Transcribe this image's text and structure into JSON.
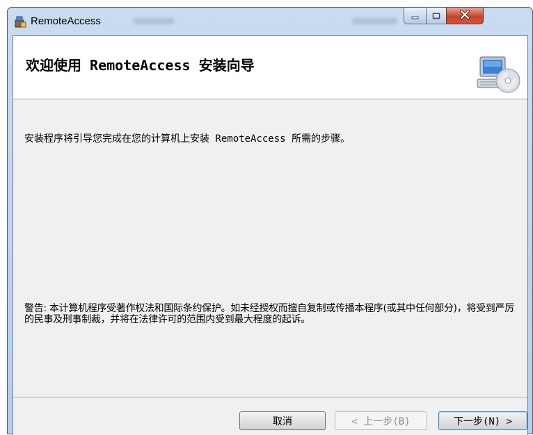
{
  "window": {
    "title": "RemoteAccess",
    "controls": {
      "minimize_icon": "minimize-icon",
      "maximize_icon": "maximize-icon",
      "close_icon": "close-icon"
    }
  },
  "banner": {
    "title": "欢迎使用 RemoteAccess 安装向导",
    "graphic_icon": "computer-cd-icon"
  },
  "body": {
    "welcome": "安装程序将引导您完成在您的计算机上安装 RemoteAccess 所需的步骤。",
    "warning": "警告: 本计算机程序受著作权法和国际条约保护。如未经授权而擅自复制或传播本程序(或其中任何部分)，将受到严厉的民事及刑事制裁，并将在法律许可的范围内受到最大程度的起诉。"
  },
  "buttons": {
    "cancel": "取消",
    "back": "< 上一步(B)",
    "next": "下一步(N) >"
  },
  "colors": {
    "close_button": "#c8432d",
    "client_background": "#f0f0f0",
    "default_button_border": "#3c7fb1"
  }
}
